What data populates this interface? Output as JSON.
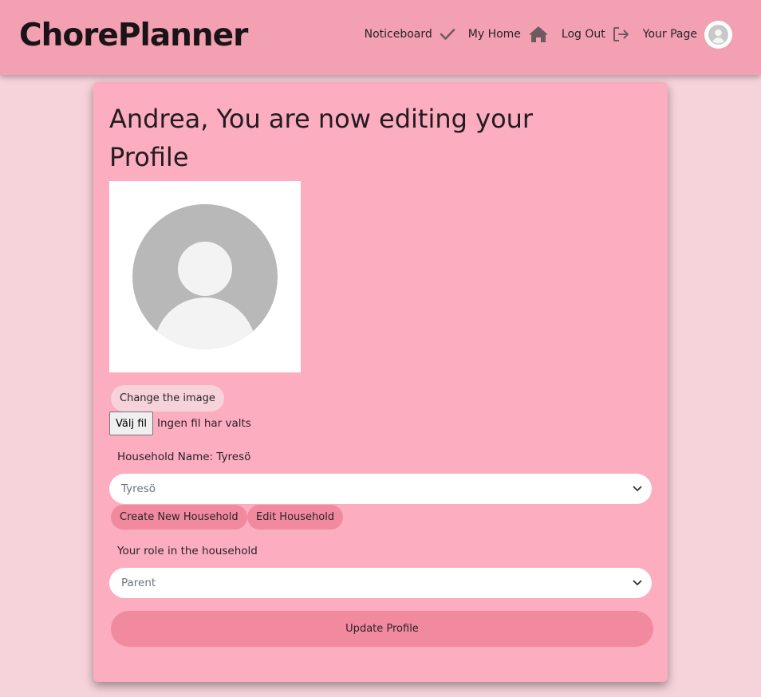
{
  "app": {
    "brand": "ChorePlanner"
  },
  "nav": {
    "items": [
      {
        "label": "Noticeboard",
        "icon": "check-icon"
      },
      {
        "label": "My Home",
        "icon": "home-icon"
      },
      {
        "label": "Log Out",
        "icon": "logout-icon"
      },
      {
        "label": "Your Page",
        "icon": "avatar"
      }
    ]
  },
  "profile": {
    "title": "Andrea, You are now editing your Profile",
    "change_image_label": "Change the image",
    "file_button_label": "Välj fil",
    "file_status": "Ingen fil har valts",
    "household_label": "Household Name: Tyresö",
    "household_selected": "Tyresö",
    "create_household_label": "Create New Household",
    "edit_household_label": "Edit Household",
    "role_label": "Your role in the household",
    "role_selected": "Parent",
    "update_label": "Update Profile"
  },
  "colors": {
    "page_bg": "#f6d3da",
    "navbar_bg": "#f2a0b2",
    "card_bg": "#fcadc0",
    "button_accent": "#f28a9f",
    "button_light": "#f6d3da",
    "placeholder_avatar": "#b8b8b8"
  }
}
